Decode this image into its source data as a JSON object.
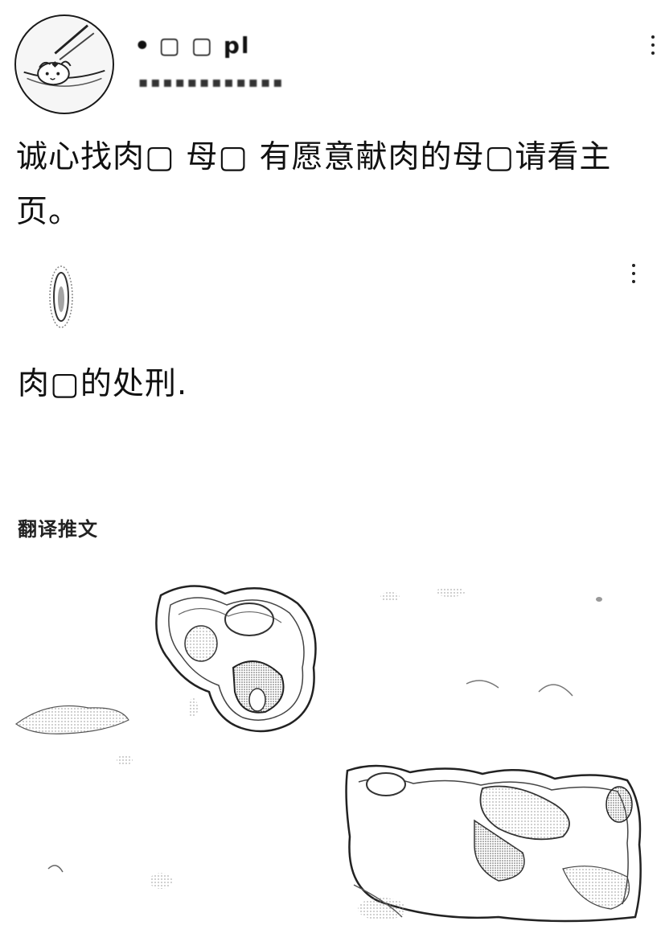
{
  "post": {
    "author_name": "ꔷ ▢ ▢ pl",
    "author_handle": "▪▪▪▪▪▪▪▪▪▪▪▪",
    "text": "诚心找肉▢ 母▢ 有愿意献肉的母▢请看主页。"
  },
  "quoted": {
    "text": "肉▢的处刑."
  },
  "actions": {
    "translate_label": "翻译推文"
  },
  "icons": {
    "more_top": "more-vertical-icon",
    "more_mid": "more-vertical-icon"
  },
  "colors": {
    "text": "#111111",
    "background": "#ffffff"
  }
}
